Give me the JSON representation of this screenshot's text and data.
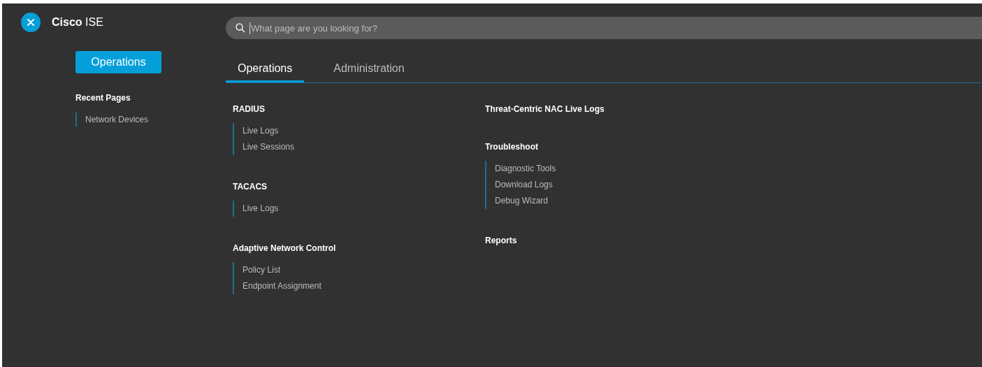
{
  "app": {
    "title": "**Cisco** ISE"
  },
  "search": {
    "placeholder": "What page are you looking for?"
  },
  "sidebar": {
    "button": "Operations",
    "recent_heading": "Recent Pages",
    "recent_items": [
      "Network Devices"
    ]
  },
  "tabs": [
    {
      "label": "Operations",
      "selected": true
    },
    {
      "label": "Administration",
      "selected": false
    }
  ],
  "columns": [
    [
      {
        "heading": "RADIUS",
        "items": [
          "Live Logs",
          "Live Sessions"
        ]
      },
      {
        "heading": "TACACS",
        "items": [
          "Live Logs"
        ]
      },
      {
        "heading": "Adaptive Network Control",
        "items": [
          "Policy List",
          "Endpoint Assignment"
        ]
      }
    ],
    [
      {
        "heading": "Threat-Centric NAC Live Logs"
      },
      {
        "heading": "Troubleshoot",
        "items": [
          "Diagnostic Tools",
          "Download Logs",
          "Debug Wizard"
        ]
      },
      {
        "heading": "Reports"
      }
    ]
  ]
}
